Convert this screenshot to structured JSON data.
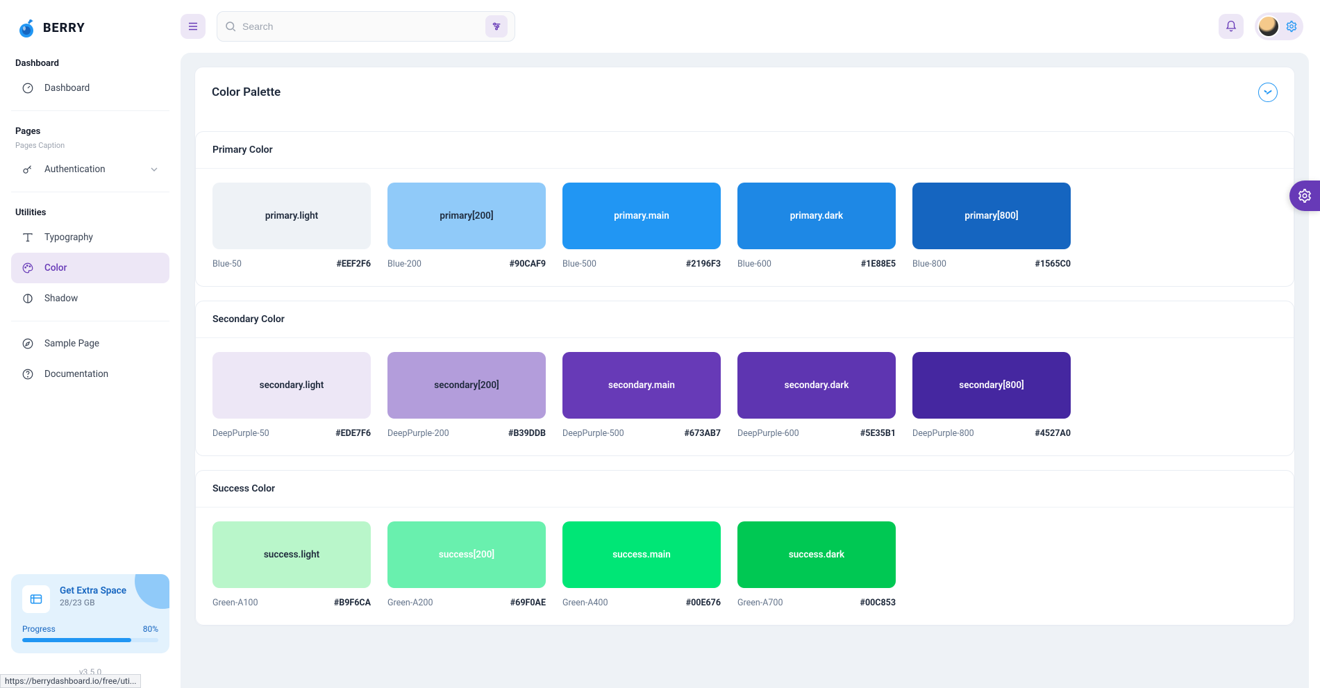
{
  "brand": "BERRY",
  "search": {
    "placeholder": "Search"
  },
  "nav": {
    "dashboard_section": "Dashboard",
    "dashboard": "Dashboard",
    "pages_section": "Pages",
    "pages_caption": "Pages Caption",
    "authentication": "Authentication",
    "utilities_section": "Utilities",
    "typography": "Typography",
    "color": "Color",
    "shadow": "Shadow",
    "sample_page": "Sample Page",
    "documentation": "Documentation"
  },
  "extra": {
    "title": "Get Extra Space",
    "subtitle": "28/23 GB",
    "progress_label": "Progress",
    "progress_pct": "80%"
  },
  "version": "v3.5.0",
  "page": {
    "title": "Color Palette"
  },
  "sections": {
    "primary": {
      "title": "Primary Color",
      "items": [
        {
          "label": "primary.light",
          "name": "Blue-50",
          "hex": "#EEF2F6",
          "textDark": true
        },
        {
          "label": "primary[200]",
          "name": "Blue-200",
          "hex": "#90CAF9",
          "textDark": true
        },
        {
          "label": "primary.main",
          "name": "Blue-500",
          "hex": "#2196F3",
          "textDark": false
        },
        {
          "label": "primary.dark",
          "name": "Blue-600",
          "hex": "#1E88E5",
          "textDark": false
        },
        {
          "label": "primary[800]",
          "name": "Blue-800",
          "hex": "#1565C0",
          "textDark": false
        }
      ]
    },
    "secondary": {
      "title": "Secondary Color",
      "items": [
        {
          "label": "secondary.light",
          "name": "DeepPurple-50",
          "hex": "#EDE7F6",
          "textDark": true
        },
        {
          "label": "secondary[200]",
          "name": "DeepPurple-200",
          "hex": "#B39DDB",
          "textDark": true
        },
        {
          "label": "secondary.main",
          "name": "DeepPurple-500",
          "hex": "#673AB7",
          "textDark": false
        },
        {
          "label": "secondary.dark",
          "name": "DeepPurple-600",
          "hex": "#5E35B1",
          "textDark": false
        },
        {
          "label": "secondary[800]",
          "name": "DeepPurple-800",
          "hex": "#4527A0",
          "textDark": false
        }
      ]
    },
    "success": {
      "title": "Success Color",
      "items": [
        {
          "label": "success.light",
          "name": "Green-A100",
          "hex": "#B9F6CA",
          "textDark": true
        },
        {
          "label": "success[200]",
          "name": "Green-A200",
          "hex": "#69F0AE",
          "textDark": false
        },
        {
          "label": "success.main",
          "name": "Green-A400",
          "hex": "#00E676",
          "textDark": false
        },
        {
          "label": "success.dark",
          "name": "Green-A700",
          "hex": "#00C853",
          "textDark": false
        }
      ]
    }
  },
  "status_url": "https://berrydashboard.io/free/uti..."
}
